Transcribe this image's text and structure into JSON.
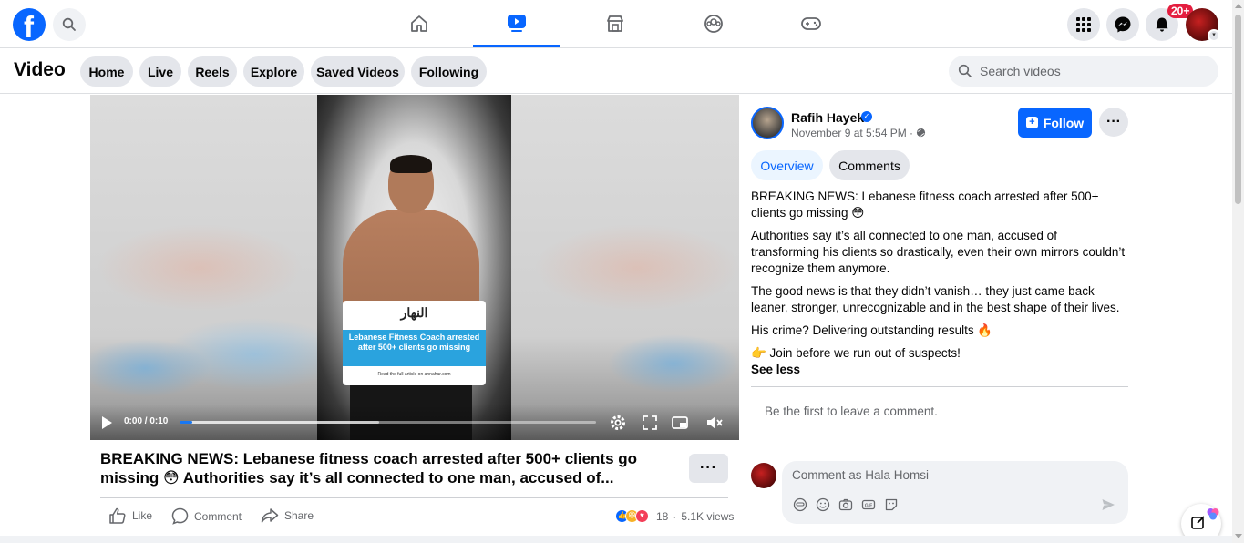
{
  "topnav": {
    "notification_badge": "20+",
    "tabs": [
      {
        "icon": "home-icon",
        "active": false
      },
      {
        "icon": "video-icon",
        "active": true
      },
      {
        "icon": "marketplace-icon",
        "active": false
      },
      {
        "icon": "groups-icon",
        "active": false
      },
      {
        "icon": "gaming-icon",
        "active": false
      }
    ]
  },
  "subheader": {
    "title": "Video",
    "tabs": [
      "Home",
      "Live",
      "Reels",
      "Explore",
      "Saved Videos",
      "Following"
    ],
    "search_placeholder": "Search videos"
  },
  "player": {
    "time": "0:00 / 0:10",
    "progress_fraction": 0.03,
    "buffered_fraction": 0.48,
    "overlay_card": {
      "logo": "النهار",
      "headline": "Lebanese Fitness Coach arrested after 500+ clients go missing",
      "footer": "Read the full article on annahar.com"
    }
  },
  "video": {
    "title": "BREAKING NEWS: Lebanese fitness coach arrested after 500+ clients go missing 😳 Authorities say it’s all connected to one man, accused of...",
    "more_label": "···",
    "actions": {
      "like": "Like",
      "comment": "Comment",
      "share": "Share"
    },
    "reaction_count": "18",
    "views": "5.1K views"
  },
  "post": {
    "author": "Rafih Hayek",
    "date": "November 9 at 5:54 PM ·",
    "follow_label": "Follow",
    "more_label": "···",
    "tabs": {
      "overview": "Overview",
      "comments": "Comments"
    },
    "description": [
      "BREAKING NEWS: Lebanese fitness coach arrested after 500+ clients go missing 😳",
      "Authorities say it’s all connected to one man, accused of transforming his clients so drastically, even their own mirrors couldn’t recognize them anymore.",
      "The good news is that they didn’t vanish… they just came back leaner, stronger, unrecognizable and in the best shape of their lives.",
      "His crime? Delivering outstanding results 🔥",
      "👉 Join before we run out of suspects!"
    ],
    "see_less": "See less",
    "no_comments": "Be the first to leave a comment.",
    "comment_placeholder": "Comment as Hala Homsi"
  },
  "colors": {
    "brand": "#0866ff",
    "badge": "#e41e3f"
  }
}
